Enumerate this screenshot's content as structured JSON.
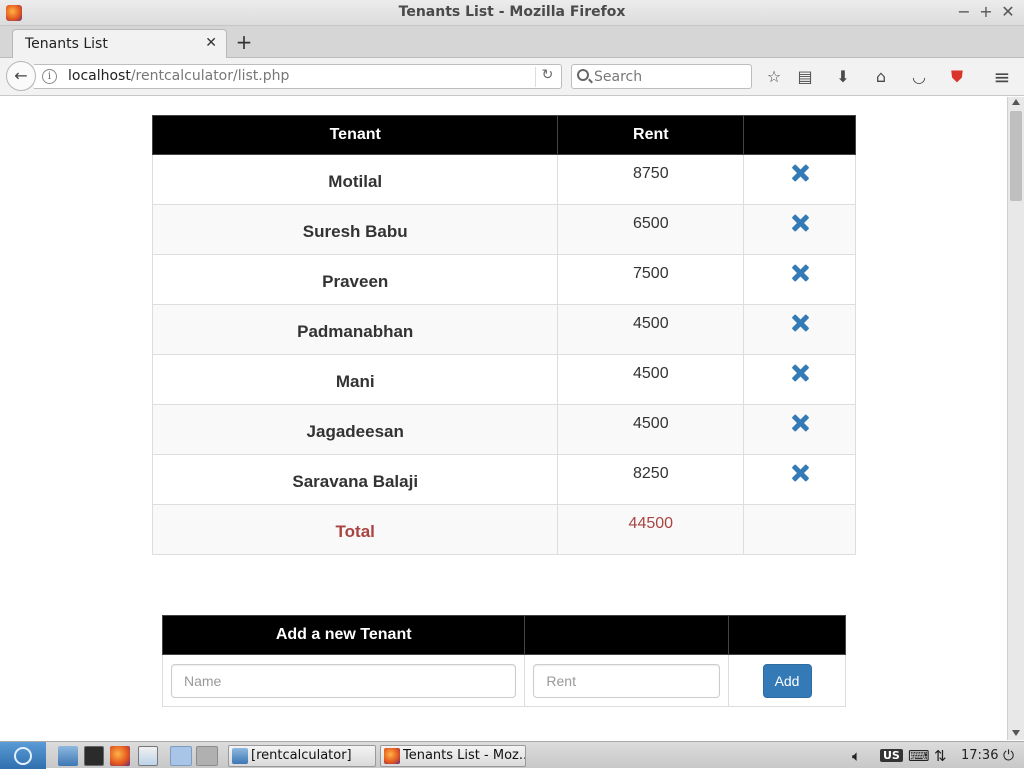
{
  "window": {
    "title": "Tenants List - Mozilla Firefox",
    "controls": {
      "minimize": "−",
      "maximize": "+",
      "close": "✕"
    }
  },
  "tabs": [
    {
      "label": "Tenants List",
      "close": "✕"
    }
  ],
  "newtab_label": "+",
  "navbar": {
    "back": "←",
    "url_host": "localhost",
    "url_path": "/rentcalculator/list.php",
    "reload": "↻",
    "search_placeholder": "Search",
    "icons": [
      "star-icon",
      "reading-list-icon",
      "download-icon",
      "home-icon",
      "pocket-icon",
      "shield-icon",
      "menu-icon"
    ],
    "icon_glyphs": {
      "star": "☆",
      "reading": "▤",
      "download": "⬇",
      "home": "⌂",
      "pocket": "◡",
      "shield": "⛊",
      "menu": "≡"
    }
  },
  "tenants_table": {
    "headers": {
      "tenant": "Tenant",
      "rent": "Rent",
      "action": ""
    },
    "rows": [
      {
        "name": "Motilal",
        "rent": "8750"
      },
      {
        "name": "Suresh Babu",
        "rent": "6500"
      },
      {
        "name": "Praveen",
        "rent": "7500"
      },
      {
        "name": "Padmanabhan",
        "rent": "4500"
      },
      {
        "name": "Mani",
        "rent": "4500"
      },
      {
        "name": "Jagadeesan",
        "rent": "4500"
      },
      {
        "name": "Saravana Balaji",
        "rent": "8250"
      }
    ],
    "total": {
      "label": "Total",
      "value": "44500"
    }
  },
  "add_form": {
    "header": "Add a new Tenant",
    "name_placeholder": "Name",
    "rent_placeholder": "Rent",
    "button_label": "Add"
  },
  "taskbar": {
    "tasks": [
      {
        "label": "[rentcalculator]"
      },
      {
        "label": "Tenants List - Moz..."
      }
    ],
    "keyboard_layout": "US",
    "clock": "17:36"
  },
  "colors": {
    "accent": "#337ab7",
    "total_text": "#a94442",
    "header_bg": "#000000"
  }
}
